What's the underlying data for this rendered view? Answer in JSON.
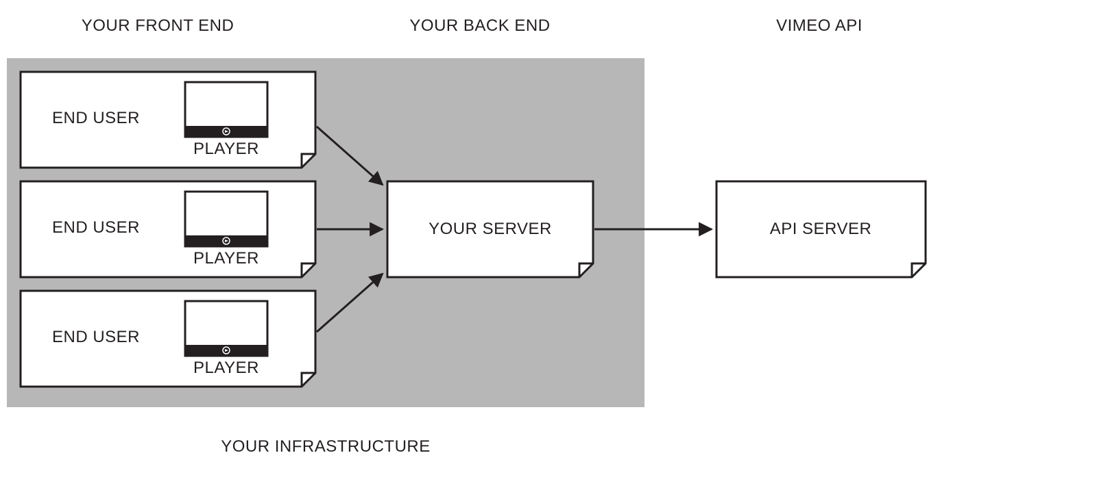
{
  "headings": {
    "frontend": "YOUR FRONT END",
    "backend": "YOUR BACK END",
    "api": "VIMEO API"
  },
  "frontend_nodes": [
    {
      "user_label": "END USER",
      "player_label": "PLAYER"
    },
    {
      "user_label": "END USER",
      "player_label": "PLAYER"
    },
    {
      "user_label": "END USER",
      "player_label": "PLAYER"
    }
  ],
  "backend_node": {
    "label": "YOUR SERVER"
  },
  "api_node": {
    "label": "API SERVER"
  },
  "footer": {
    "label": "YOUR INFRASTRUCTURE"
  }
}
